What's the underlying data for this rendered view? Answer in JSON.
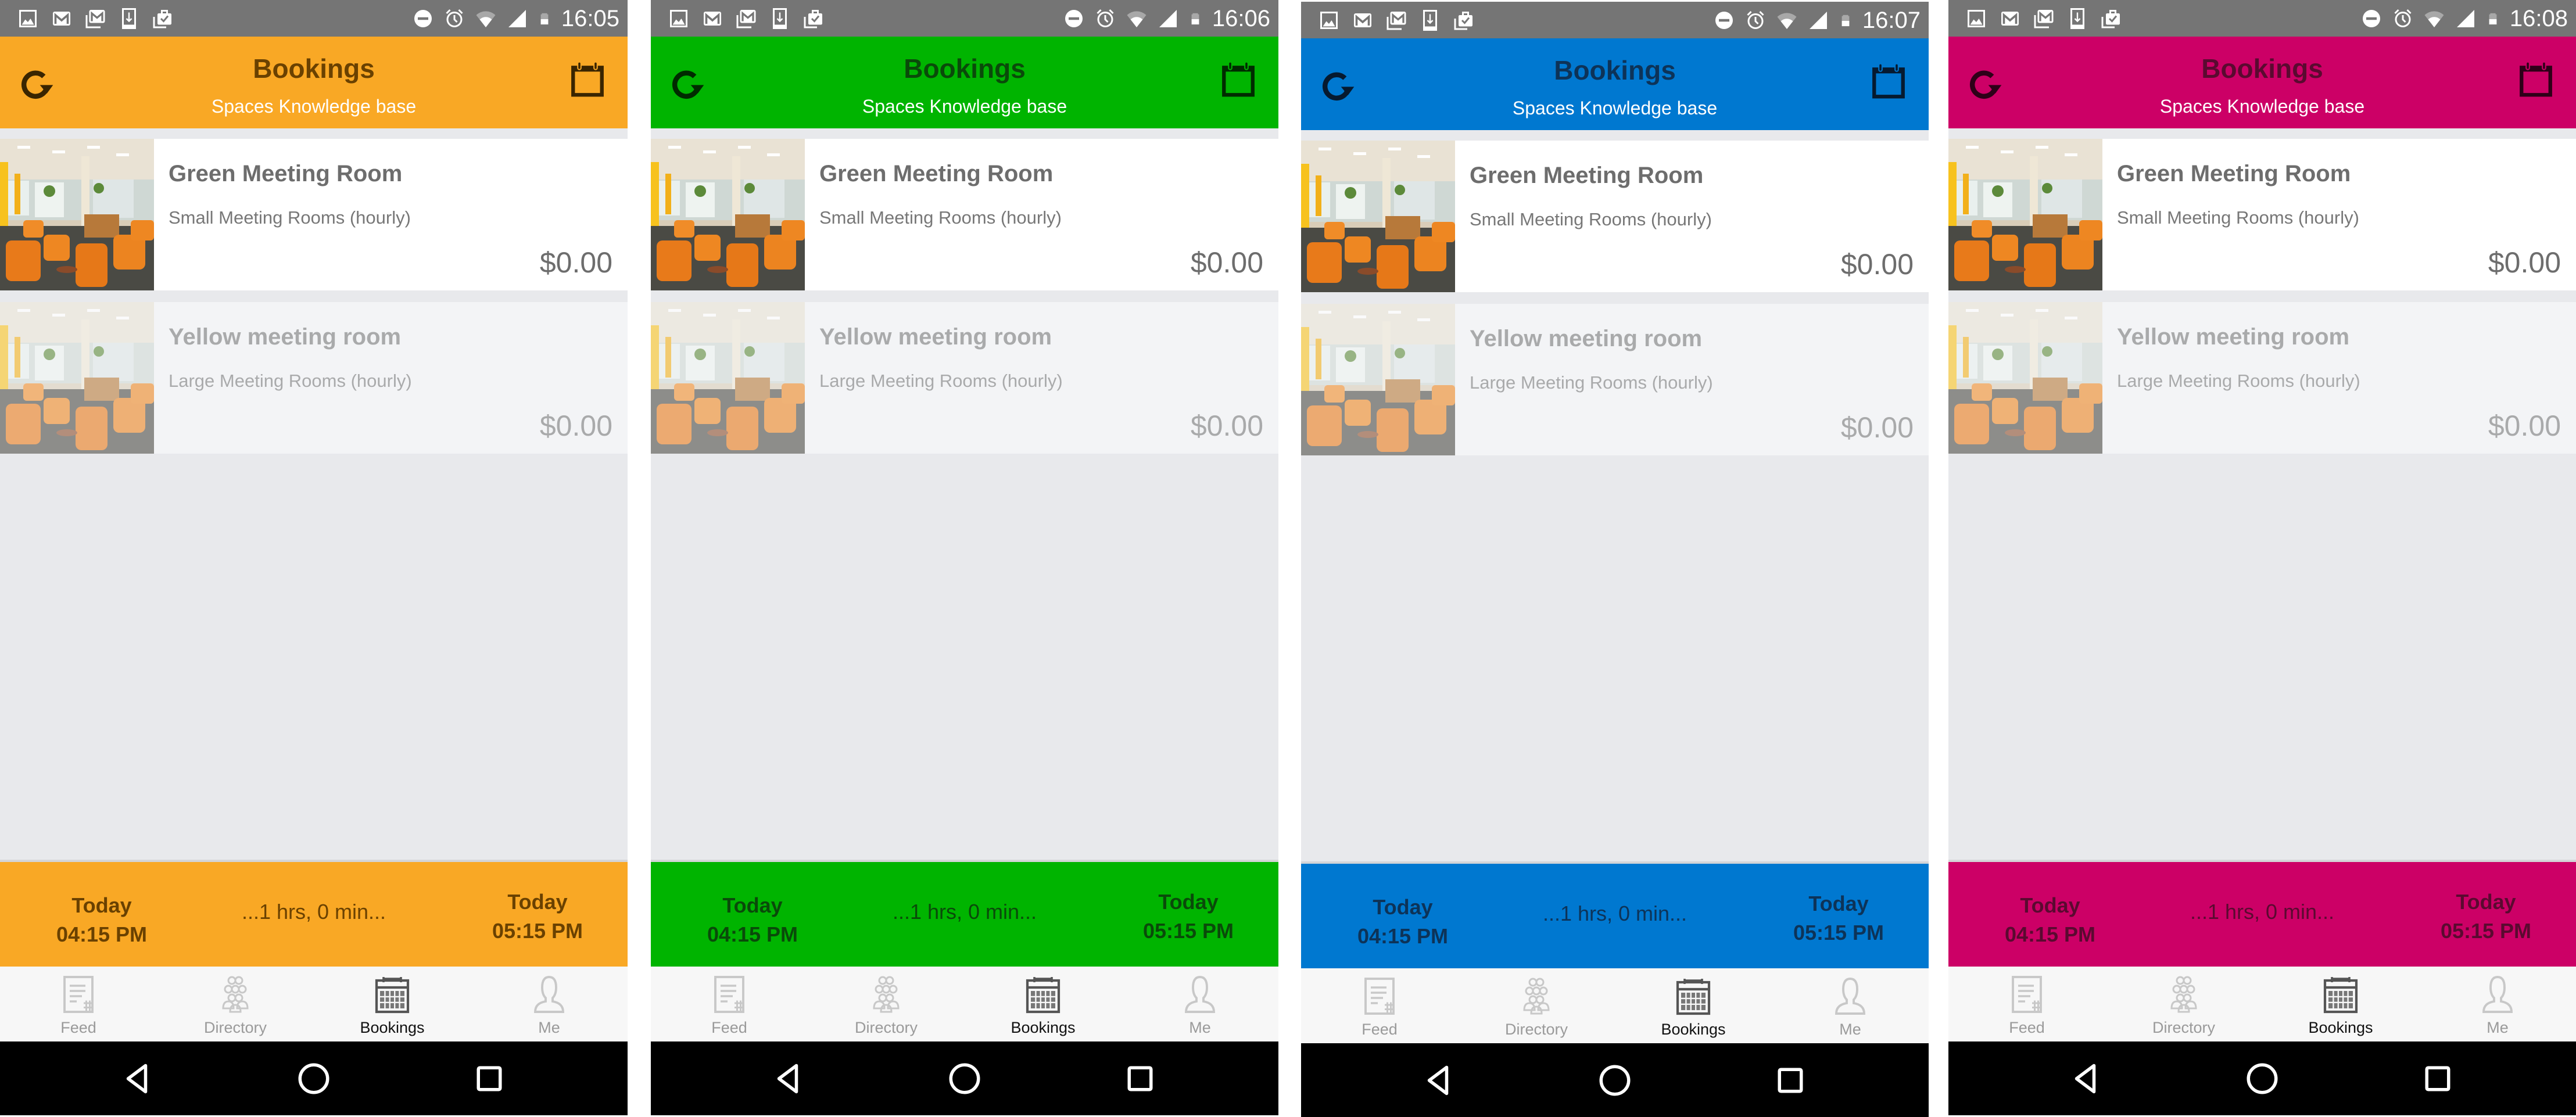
{
  "screens": [
    {
      "accent": "#f9a825",
      "ink": "#6a4100",
      "icon_ink": "#3a2500",
      "status_time": "16:05"
    },
    {
      "accent": "#00b400",
      "ink": "#0a4a0a",
      "icon_ink": "#002b00",
      "status_time": "16:06"
    },
    {
      "accent": "#0078d0",
      "ink": "#0d3358",
      "icon_ink": "#061a30",
      "status_time": "16:07"
    },
    {
      "accent": "#cc0066",
      "ink": "#5a0a30",
      "icon_ink": "#2e0018",
      "status_time": "16:08"
    }
  ],
  "statusbar": {
    "left_icons": [
      "gallery-icon",
      "gmail-icon",
      "gmail-stack-icon",
      "download-icon",
      "task-done-icon"
    ],
    "right_icons": [
      "do-not-disturb-icon",
      "alarm-icon",
      "wifi-icon",
      "cell-signal-icon",
      "battery-icon"
    ]
  },
  "header": {
    "title": "Bookings",
    "subtitle": "Spaces Knowledge base",
    "left_icon": "refresh-icon",
    "right_icon": "calendar-icon"
  },
  "rooms": [
    {
      "name": "Green Meeting Room",
      "type": "Small Meeting Rooms (hourly)",
      "price": "$0.00",
      "enabled": true
    },
    {
      "name": "Yellow meeting room",
      "type": "Large Meeting Rooms (hourly)",
      "price": "$0.00",
      "enabled": false
    }
  ],
  "timebar": {
    "start_day": "Today",
    "start_time": "04:15 PM",
    "duration": "...1 hrs, 0 min...",
    "end_day": "Today",
    "end_time": "05:15 PM"
  },
  "tabs": [
    {
      "label": "Feed",
      "icon": "feed-icon",
      "active": false
    },
    {
      "label": "Directory",
      "icon": "directory-icon",
      "active": false
    },
    {
      "label": "Bookings",
      "icon": "bookings-calendar-icon",
      "active": true
    },
    {
      "label": "Me",
      "icon": "profile-icon",
      "active": false
    }
  ],
  "navbar": [
    "back-icon",
    "home-icon",
    "recents-icon"
  ]
}
